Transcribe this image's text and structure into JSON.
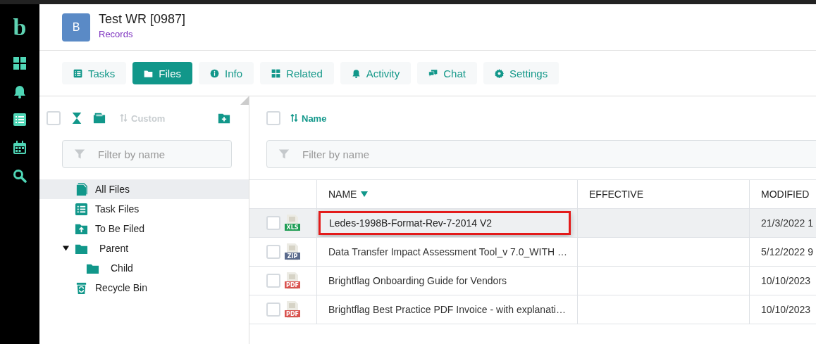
{
  "rail": {
    "logo": "b"
  },
  "header": {
    "avatar": "B",
    "title": "Test WR [0987]",
    "subtitle": "Records"
  },
  "tabs": [
    {
      "label": "Tasks",
      "selected": false
    },
    {
      "label": "Files",
      "selected": true
    },
    {
      "label": "Info",
      "selected": false
    },
    {
      "label": "Related",
      "selected": false
    },
    {
      "label": "Activity",
      "selected": false
    },
    {
      "label": "Chat",
      "selected": false
    },
    {
      "label": "Settings",
      "selected": false
    }
  ],
  "folders_pane": {
    "select_all": {
      "checked": false
    },
    "sort": {
      "label": "Custom",
      "disabled": true
    },
    "filter": {
      "placeholder": "Filter by name"
    },
    "tree": [
      {
        "label": "All Files",
        "selected": true
      },
      {
        "label": "Task Files",
        "selected": false
      },
      {
        "label": "To Be Filed",
        "selected": false
      },
      {
        "label": "Parent",
        "selected": false,
        "expanded": true,
        "children": [
          {
            "label": "Child",
            "selected": false
          }
        ]
      },
      {
        "label": "Recycle Bin",
        "selected": false
      }
    ]
  },
  "files_pane": {
    "select_all": {
      "checked": false
    },
    "sort": {
      "label": "Name"
    },
    "filter": {
      "placeholder": "Filter by name"
    },
    "table": {
      "columns": [
        {
          "label": "NAME",
          "sorted": true
        },
        {
          "label": "EFFECTIVE",
          "sorted": false
        },
        {
          "label": "MODIFIED",
          "sorted": false
        }
      ],
      "rows": [
        {
          "checked": false,
          "file_type": "XLS",
          "name": "Ledes-1998B-Format-Rev-7-2014 V2",
          "editing": true,
          "effective": "",
          "modified": "21/3/2022 1",
          "selected": true
        },
        {
          "checked": false,
          "file_type": "ZIP",
          "name": "Data Transfer Impact Assessment Tool_v 7.0_WITH …",
          "editing": false,
          "modified": "5/12/2022 9",
          "selected": false
        },
        {
          "checked": false,
          "file_type": "PDF",
          "name": "Brightflag Onboarding Guide for Vendors",
          "editing": false,
          "modified": "10/10/2023",
          "selected": false
        },
        {
          "checked": false,
          "file_type": "PDF",
          "name": "Brightflag Best Practice PDF Invoice - with explanati…",
          "editing": false,
          "modified": "10/10/2023",
          "selected": false
        }
      ]
    }
  }
}
